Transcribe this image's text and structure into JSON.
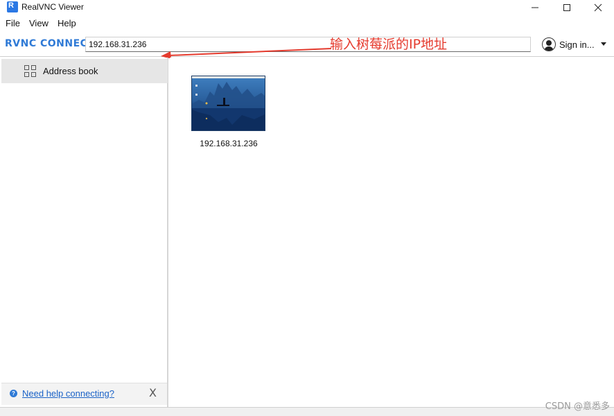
{
  "window": {
    "title": "RealVNC Viewer",
    "icon": "realvnc-app-icon",
    "icon_glyph": "R"
  },
  "menu": {
    "file": "File",
    "view": "View",
    "help": "Help"
  },
  "toolbar": {
    "logo": "RVNC CONNECT",
    "address_value": "192.168.31.236",
    "sign_in_label": "Sign in..."
  },
  "annotation": {
    "text": "输入树莓派的IP地址",
    "color": "#e53b2e"
  },
  "sidebar": {
    "address_book_label": "Address book",
    "help_link": "Need help connecting?",
    "help_close": "X",
    "help_icon_glyph": "?"
  },
  "main": {
    "computers": [
      {
        "label": "192.168.31.236",
        "thumbnail": "desktop-thumbnail"
      }
    ]
  },
  "watermark": "CSDN @意悉多",
  "colors": {
    "accent": "#2f7ad6",
    "link": "#1a62c7",
    "selected_bg": "#e6e6e6"
  }
}
